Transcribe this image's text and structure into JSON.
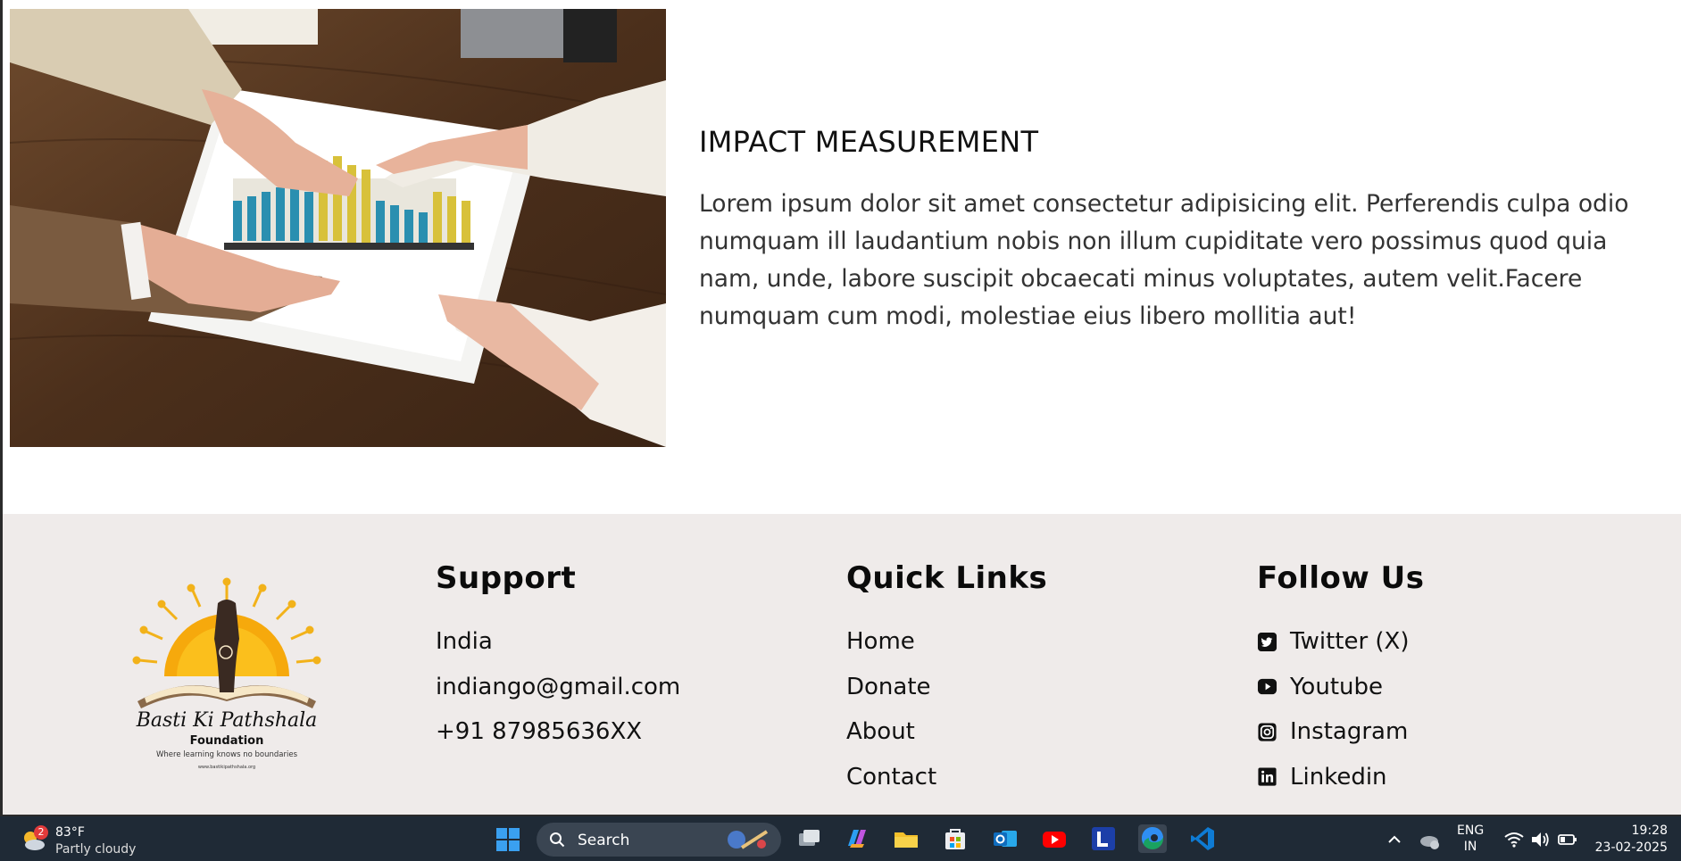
{
  "impact": {
    "title": "IMPACT MEASUREMENT",
    "body": "Lorem ipsum dolor sit amet consectetur adipisicing elit. Perferendis culpa odio numquam ill laudantium nobis non illum cupiditate vero possimus quod quia nam, unde, labore suscipit obcaecati minus voluptates, autem velit.Facere numquam cum modi, molestiae eius libero mollitia aut!"
  },
  "footer": {
    "logo": {
      "name": "Basti Ki Pathshala",
      "subtitle": "Foundation",
      "tagline": "Where learning knows no boundaries",
      "url": "www.bastikipathshala.org"
    },
    "support": {
      "heading": "Support",
      "items": [
        "India",
        "indiango@gmail.com",
        "+91 87985636XX"
      ]
    },
    "quick_links": {
      "heading": "Quick Links",
      "items": [
        "Home",
        "Donate",
        "About",
        "Contact"
      ]
    },
    "follow": {
      "heading": "Follow Us",
      "items": [
        {
          "label": "Twitter (X)",
          "icon": "twitter-icon"
        },
        {
          "label": "Youtube",
          "icon": "youtube-icon"
        },
        {
          "label": "Instagram",
          "icon": "instagram-icon"
        },
        {
          "label": "Linkedin",
          "icon": "linkedin-icon"
        }
      ]
    }
  },
  "taskbar": {
    "weather": {
      "badge": "2",
      "temp": "83°F",
      "condition": "Partly cloudy"
    },
    "search_label": "Search",
    "apps": [
      "task-view",
      "copilot",
      "file-explorer",
      "microsoft-store",
      "outlook",
      "youtube",
      "l-app",
      "edge",
      "vscode"
    ],
    "language": {
      "line1": "ENG",
      "line2": "IN"
    },
    "clock": {
      "time": "19:28",
      "date": "23-02-2025"
    }
  },
  "colors": {
    "footer_bg": "#efebea",
    "taskbar_bg": "#1f2a36",
    "text": "#111111"
  }
}
